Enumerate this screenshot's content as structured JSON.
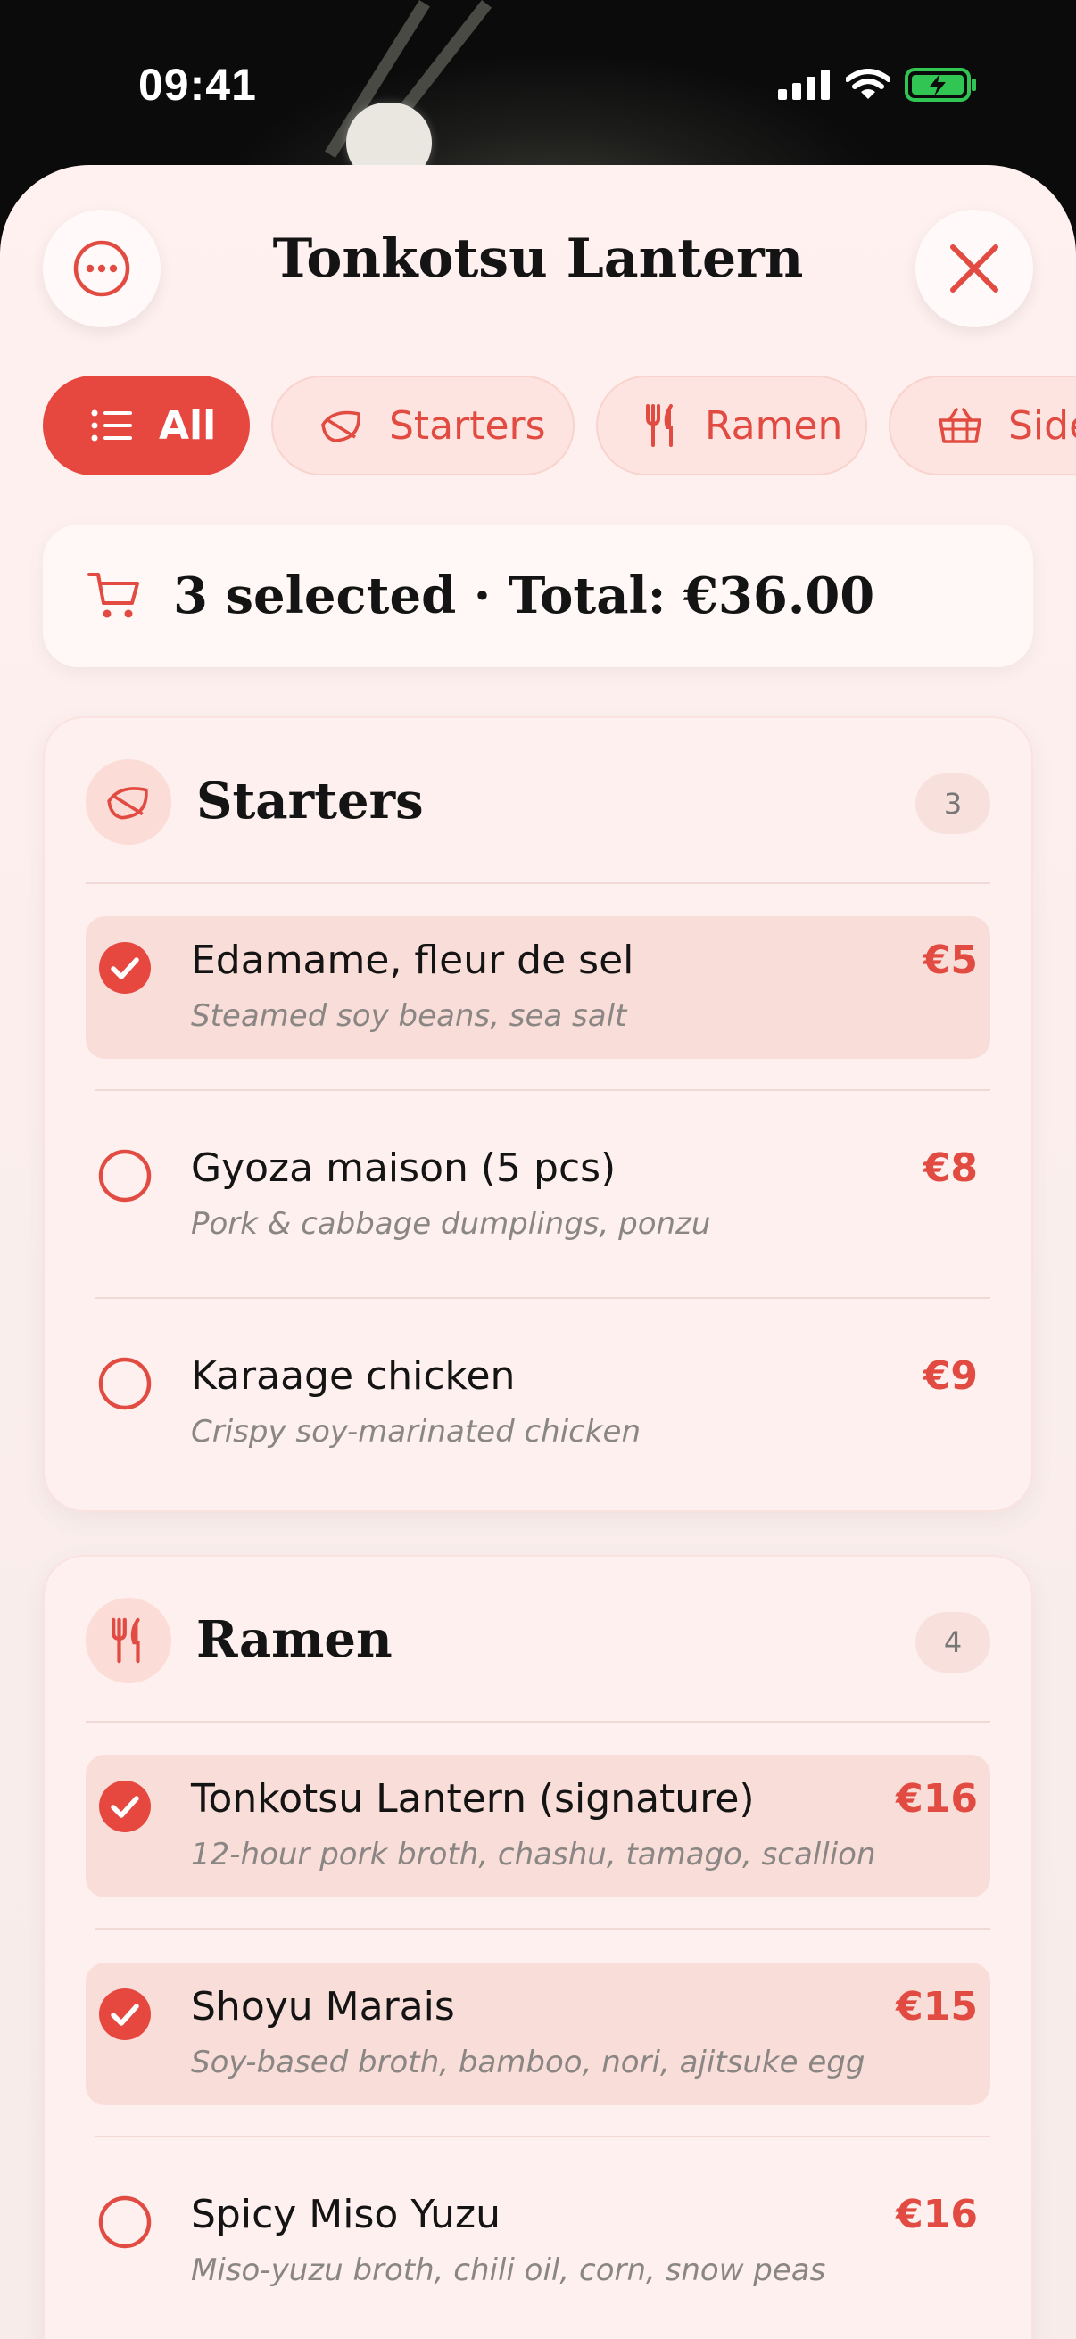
{
  "status_bar": {
    "time": "09:41",
    "icons": [
      "signal-icon",
      "wifi-icon",
      "battery-charging-icon"
    ]
  },
  "header": {
    "title": "Tonkotsu Lantern",
    "more_icon": "more-icon",
    "close_icon": "close-icon"
  },
  "filters": [
    {
      "label": "All",
      "icon": "list-icon",
      "active": true
    },
    {
      "label": "Starters",
      "icon": "leaf-icon",
      "active": false
    },
    {
      "label": "Ramen",
      "icon": "fork-knife-icon",
      "active": false
    },
    {
      "label": "Sides",
      "icon": "basket-icon",
      "active": false
    }
  ],
  "summary": {
    "icon": "cart-icon",
    "text": "3 selected · Total: €36.00"
  },
  "sections": [
    {
      "title": "Starters",
      "icon": "leaf-icon",
      "count": "3",
      "items": [
        {
          "name": "Edamame, fleur de sel",
          "description": "Steamed soy beans, sea salt",
          "price": "€5",
          "selected": true
        },
        {
          "name": "Gyoza maison (5 pcs)",
          "description": "Pork & cabbage dumplings, ponzu",
          "price": "€8",
          "selected": false
        },
        {
          "name": "Karaage chicken",
          "description": "Crispy soy-marinated chicken",
          "price": "€9",
          "selected": false
        }
      ]
    },
    {
      "title": "Ramen",
      "icon": "fork-knife-icon",
      "count": "4",
      "items": [
        {
          "name": "Tonkotsu Lantern (signature)",
          "description": "12-hour pork broth, chashu, tamago, scallion",
          "price": "€16",
          "selected": true
        },
        {
          "name": "Shoyu Marais",
          "description": "Soy-based broth, bamboo, nori, ajitsuke egg",
          "price": "€15",
          "selected": true
        },
        {
          "name": "Spicy Miso Yuzu",
          "description": "Miso-yuzu broth, chili oil, corn, snow peas",
          "price": "€16",
          "selected": false
        }
      ]
    }
  ],
  "colors": {
    "accent": "#e6473f",
    "selected_row": "#f9ddd8",
    "sheet": "#fff1ef"
  }
}
